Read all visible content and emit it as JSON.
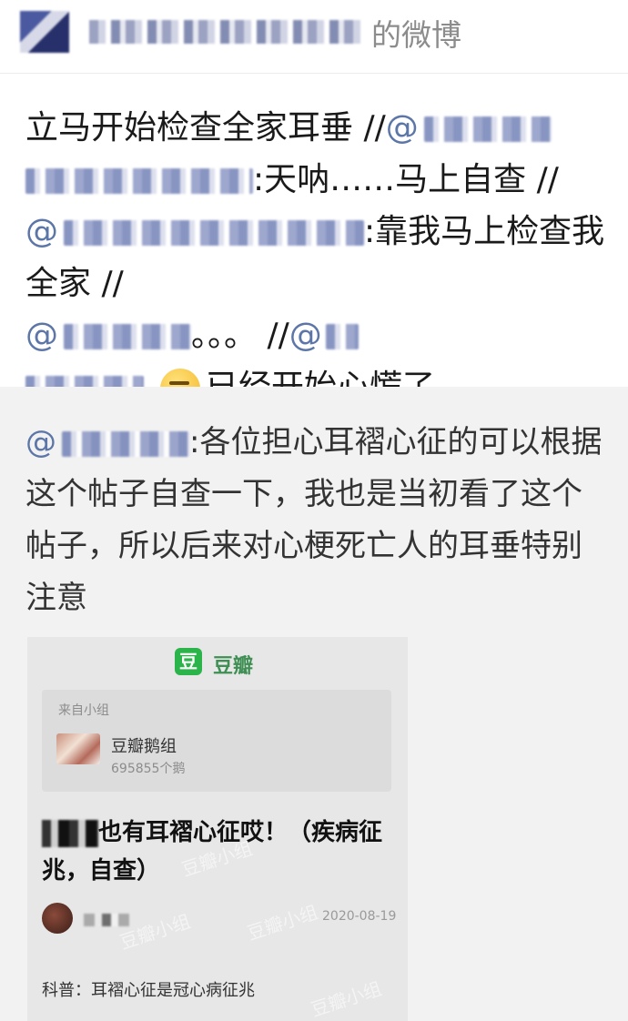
{
  "header": {
    "suffix": "的微博"
  },
  "repost": {
    "part1": "立马开始检查全家耳垂 //",
    "at1": "@",
    "part2": ":天呐……马上自查 //",
    "at2": "@",
    "part3": ":靠我马上检查我全家 //",
    "at3": "@",
    "part4": "。。。 //",
    "at4": "@",
    "part5": "已经开始心慌了",
    "emoji_icon": "embarrassed-face-icon"
  },
  "original": {
    "at": "@",
    "text": ":各位担心耳褶心征的可以根据这个帖子自查一下，我也是当初看了这个帖子，所以后来对心梗死亡人的耳垂特别注意"
  },
  "card": {
    "logo_glyph": "豆",
    "brand": "豆瓣",
    "from_label": "来自小组",
    "group_name": "豆瓣鹅组",
    "group_count": "695855个鹅",
    "title": "也有耳褶心征哎！（疾病征兆，自查）",
    "date": "2020-08-19",
    "excerpt": "科普：耳褶心征是冠心病征兆",
    "watermark": "豆瓣小组"
  },
  "colors": {
    "link": "#5d76a8",
    "douban_green": "#2bb44a",
    "background_gray": "#f2f2f2"
  }
}
